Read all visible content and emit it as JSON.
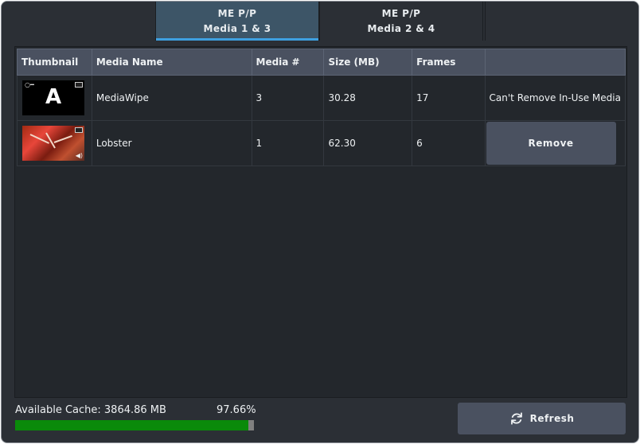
{
  "tabs": [
    {
      "line1": "ME P/P",
      "line2": "Media 1 & 3",
      "active": true
    },
    {
      "line1": "ME P/P",
      "line2": "Media 2 & 4",
      "active": false
    }
  ],
  "table": {
    "headers": [
      "Thumbnail",
      "Media Name",
      "Media #",
      "Size (MB)",
      "Frames",
      ""
    ],
    "rows": [
      {
        "thumbnail_letter": "A",
        "name": "MediaWipe",
        "media_num": "3",
        "size_mb": "30.28",
        "frames": "17",
        "action": "Can't Remove In-Use Media"
      },
      {
        "name": "Lobster",
        "media_num": "1",
        "size_mb": "62.30",
        "frames": "6",
        "action": "Remove"
      }
    ]
  },
  "cache": {
    "label": "Available Cache: 3864.86 MB",
    "percent": "97.66%",
    "fraction": 0.9766
  },
  "refresh": {
    "label": "Refresh",
    "icon": "refresh-icon"
  },
  "colors": {
    "accent": "#3ea0e0",
    "progress": "#0a8a0a",
    "button": "#4a5160"
  }
}
